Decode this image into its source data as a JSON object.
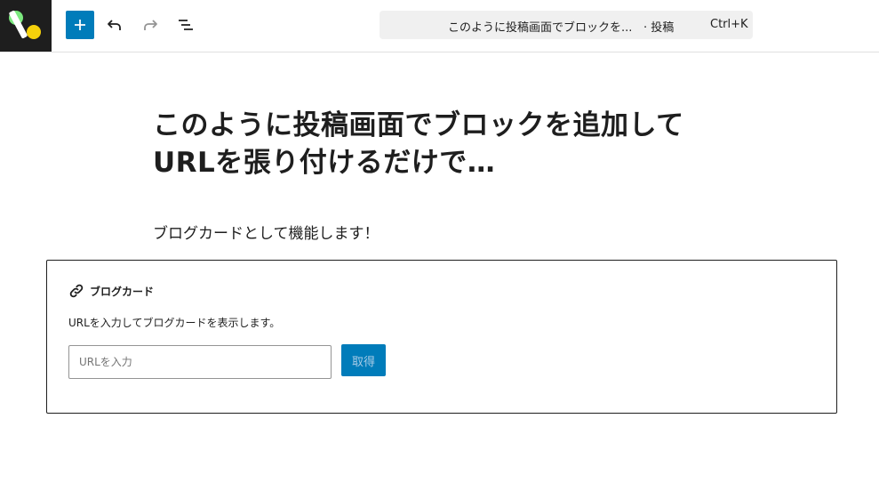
{
  "toolbar": {
    "add_block_icon": "plus-icon",
    "undo_icon": "undo-icon",
    "redo_icon": "redo-icon",
    "document_overview_icon": "list-view-icon",
    "logo_colors": {
      "background": "#1e1e1e",
      "green": "#7be87e",
      "yellow": "#f5d10b"
    },
    "accent_color": "#007cba"
  },
  "command_bar": {
    "title": "このように投稿画面でブロックを...",
    "post_type": "· 投稿",
    "shortcut": "Ctrl+K"
  },
  "post": {
    "title": "このように投稿画面でブロックを追加してURLを張り付けるだけで…",
    "paragraph": "ブログカードとして機能します！"
  },
  "blog_card_block": {
    "icon": "link-icon",
    "label": "ブログカード",
    "instructions": "URLを入力してブログカードを表示します。",
    "input_placeholder": "URLを入力",
    "input_value": "",
    "submit_label": "取得"
  }
}
